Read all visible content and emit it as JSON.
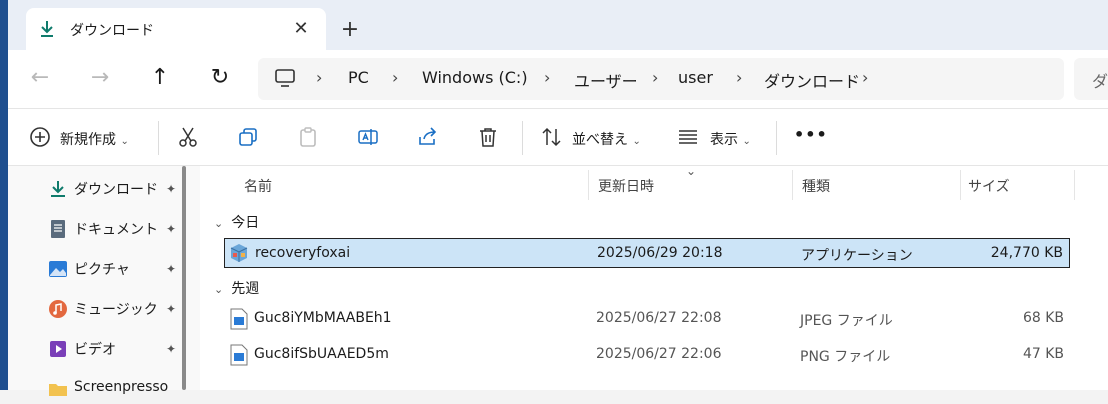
{
  "tab": {
    "title": "ダウンロード",
    "close": "✕",
    "new_tab": "+"
  },
  "nav": {
    "back": "←",
    "forward": "→",
    "up": "↑",
    "refresh": "↻",
    "breadcrumbs": [
      "PC",
      "Windows (C:)",
      "ユーザー",
      "user",
      "ダウンロード"
    ],
    "separator": "›",
    "search_placeholder": "ダ"
  },
  "toolbar": {
    "new_label": "新規作成",
    "sort_label": "並べ替え",
    "view_label": "表示",
    "more": "•••"
  },
  "sidebar": {
    "items": [
      {
        "label": "ダウンロード",
        "icon": "download-icon"
      },
      {
        "label": "ドキュメント",
        "icon": "document-icon"
      },
      {
        "label": "ピクチャ",
        "icon": "pictures-icon"
      },
      {
        "label": "ミュージック",
        "icon": "music-icon"
      },
      {
        "label": "ビデオ",
        "icon": "video-icon"
      },
      {
        "label": "Screenpresso",
        "icon": "folder-icon"
      }
    ],
    "pin": "📌"
  },
  "columns": [
    "名前",
    "更新日時",
    "種類",
    "サイズ"
  ],
  "groups": [
    {
      "label": "今日",
      "files": [
        {
          "name": "recoveryfoxai",
          "date": "2025/06/29 20:18",
          "type": "アプリケーション",
          "size": "24,770 KB",
          "selected": true
        }
      ]
    },
    {
      "label": "先週",
      "files": [
        {
          "name": "Guc8iYMbMAABEh1",
          "date": "2025/06/27 22:08",
          "type": "JPEG ファイル",
          "size": "68 KB"
        },
        {
          "name": "Guc8ifSbUAAED5m",
          "date": "2025/06/27 22:06",
          "type": "PNG ファイル",
          "size": "47 KB"
        }
      ]
    }
  ],
  "colors": {
    "selection": "#cce4f7",
    "accent": "#0f7b6c",
    "address_bg": "#f5f5f5"
  }
}
